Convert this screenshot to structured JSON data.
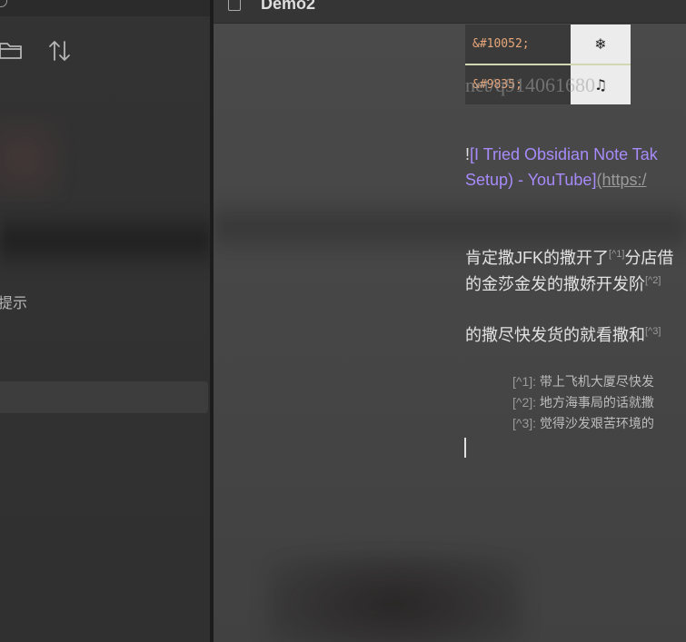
{
  "sidebar": {
    "hint_label": "提示",
    "icons": {
      "top": "history-icon",
      "folder": "folder-icon",
      "sort": "sort-icon"
    }
  },
  "tab": {
    "title": "Demo2",
    "icon": "file-icon"
  },
  "table": {
    "rows": [
      {
        "code": "&#10052;",
        "symbol": "❄"
      },
      {
        "code": "&#9835;",
        "symbol": "♫"
      }
    ],
    "watermark": "net/q914061680"
  },
  "link": {
    "bang": "!",
    "text_part1": "[I Tried Obsidian Note Tak",
    "text_part2": "Setup) - YouTube]",
    "url": "(https:/"
  },
  "paragraphs": [
    {
      "text": "肯定撒JFK的撒开了",
      "ref": "[^1]",
      "tail": "分店借"
    },
    {
      "text": "的金莎金发的撒娇开发阶",
      "ref": "[^2]",
      "tail": ""
    },
    {
      "text": "的撒尽快发货的就看撒和",
      "ref": "[^3]",
      "tail": ""
    }
  ],
  "footnotes": [
    {
      "mark": "[^1]:",
      "text": "带上飞机大厦尽快发"
    },
    {
      "mark": "[^2]:",
      "text": "地方海事局的话就撒"
    },
    {
      "mark": "[^3]:",
      "text": "觉得沙发艰苦环境的"
    }
  ],
  "colors": {
    "sidebar_bg": "#333333",
    "editor_bg": "#474747",
    "link": "#a78bfa",
    "code": "#e8a77a"
  }
}
